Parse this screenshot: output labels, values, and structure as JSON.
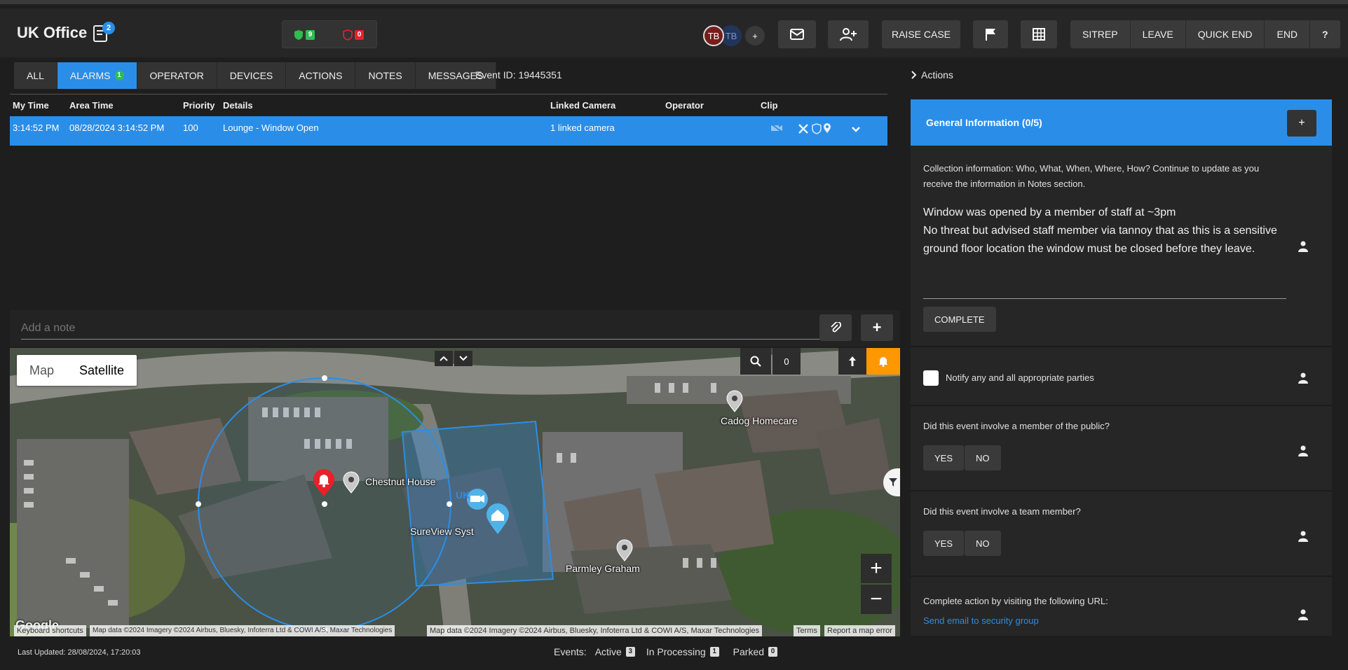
{
  "header": {
    "title": "UK Office",
    "notes_count": "2",
    "shield_green_count": "9",
    "shield_red_count": "0",
    "avatars": [
      "TB",
      "TB"
    ],
    "add_label": "+",
    "raise_case": "RAISE CASE",
    "sitrep": "SITREP",
    "leave": "LEAVE",
    "quick_end": "QUICK END",
    "end": "END",
    "help": "?"
  },
  "tabs": [
    {
      "label": "ALL"
    },
    {
      "label": "ALARMS",
      "count": "1"
    },
    {
      "label": "OPERATOR"
    },
    {
      "label": "DEVICES"
    },
    {
      "label": "ACTIONS"
    },
    {
      "label": "NOTES"
    },
    {
      "label": "MESSAGES"
    }
  ],
  "event_id": "Event ID: 19445351",
  "table": {
    "columns": [
      "My Time",
      "Area Time",
      "Priority",
      "Details",
      "Linked Camera",
      "Operator",
      "Clip"
    ],
    "rows": [
      {
        "my_time": "3:14:52 PM",
        "area_time": "08/28/2024 3:14:52 PM",
        "priority": "100",
        "details": "Lounge - Window Open",
        "linked_camera": "1 linked camera",
        "operator": "",
        "clip": ""
      }
    ]
  },
  "note": {
    "placeholder": "Add a note",
    "add_label": "+"
  },
  "map": {
    "type_map": "Map",
    "type_satellite": "Satellite",
    "counter": "0",
    "zoom_in": "+",
    "zoom_out": "−",
    "labels": {
      "chestnut": "Chestnut House",
      "cadog": "Cadog Homecare",
      "parmley": "Parmley Graham",
      "sureview": "SureView Syst",
      "uk": "UK"
    },
    "attribution": {
      "keyboard": "Keyboard shortcuts",
      "data1": "Map data ©2024 Imagery ©2024 Airbus, Bluesky, Infoterra Ltd & COWI A/S, Maxar Technologies",
      "data2": "Map data ©2024 Imagery ©2024 Airbus, Bluesky, Infoterra Ltd & COWI A/S, Maxar Technologies",
      "terms": "Terms",
      "report": "Report a map error"
    },
    "google": "Google"
  },
  "actions": {
    "title": "Actions",
    "general_info": "General Information (0/5)",
    "plus": "+",
    "collection_info": "Collection information: Who, What, When, Where, How? Continue to update as you receive the information in Notes section.",
    "note_line1": "Window was opened by a member of staff at ~3pm",
    "note_line2": "No threat but advised staff member via tannoy that as this is a sensitive ground floor location the window must be closed before they leave.",
    "complete": "COMPLETE",
    "notify": "Notify any and all appropriate parties",
    "q_public": "Did this event involve a member of the public?",
    "q_team": "Did this event involve a team member?",
    "yes": "YES",
    "no": "NO",
    "url_text": "Complete action by visiting the following URL:",
    "url_link": "Send email to security group"
  },
  "footer": {
    "last_updated": "Last Updated: 28/08/2024, 17:20:03",
    "events_label": "Events:",
    "active": "Active",
    "active_count": "3",
    "processing": "In Processing",
    "processing_count": "1",
    "parked": "Parked",
    "parked_count": "0"
  },
  "colors": {
    "accent": "#2a8ee8",
    "alarm_red": "#e8202a",
    "shield_green": "#2ebd4e",
    "orange": "#ff9800"
  }
}
